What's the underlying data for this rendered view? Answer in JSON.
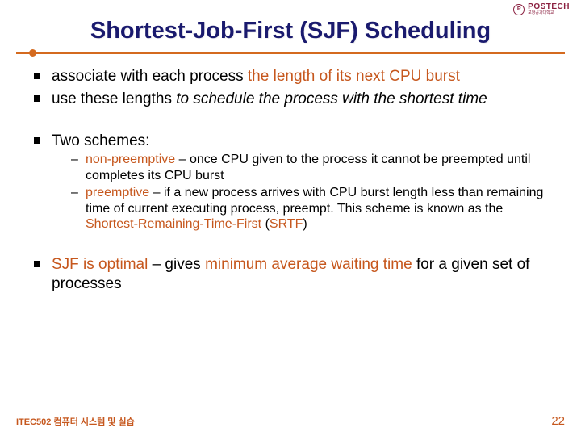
{
  "logo": {
    "main": "POSTECH",
    "sub": "포항공과대학교"
  },
  "title": "Shortest-Job-First (SJF) Scheduling",
  "bullets": {
    "b1_a": "associate with each process ",
    "b1_b": "the length of its next CPU burst",
    "b2_a": "use these lengths ",
    "b2_b": "to schedule the process with the shortest time",
    "b3": "Two schemes:",
    "s1_a": "non-preemptive",
    "s1_b": " – once CPU given to the process it cannot be preempted until completes its CPU burst",
    "s2_a": "preemptive",
    "s2_b": " – if a new process arrives with CPU burst length less than remaining time of current executing process, preempt. This scheme is known as the ",
    "s2_c": "Shortest-Remaining-Time-First",
    "s2_d": " (",
    "s2_e": "SRTF",
    "s2_f": ")",
    "b4_a": "SJF is optimal",
    "b4_b": " – gives ",
    "b4_c": "minimum average waiting time",
    "b4_d": " for a given set of processes"
  },
  "footer": {
    "course": "ITEC502 컴퓨터 시스템 및 실습",
    "page": "22"
  }
}
